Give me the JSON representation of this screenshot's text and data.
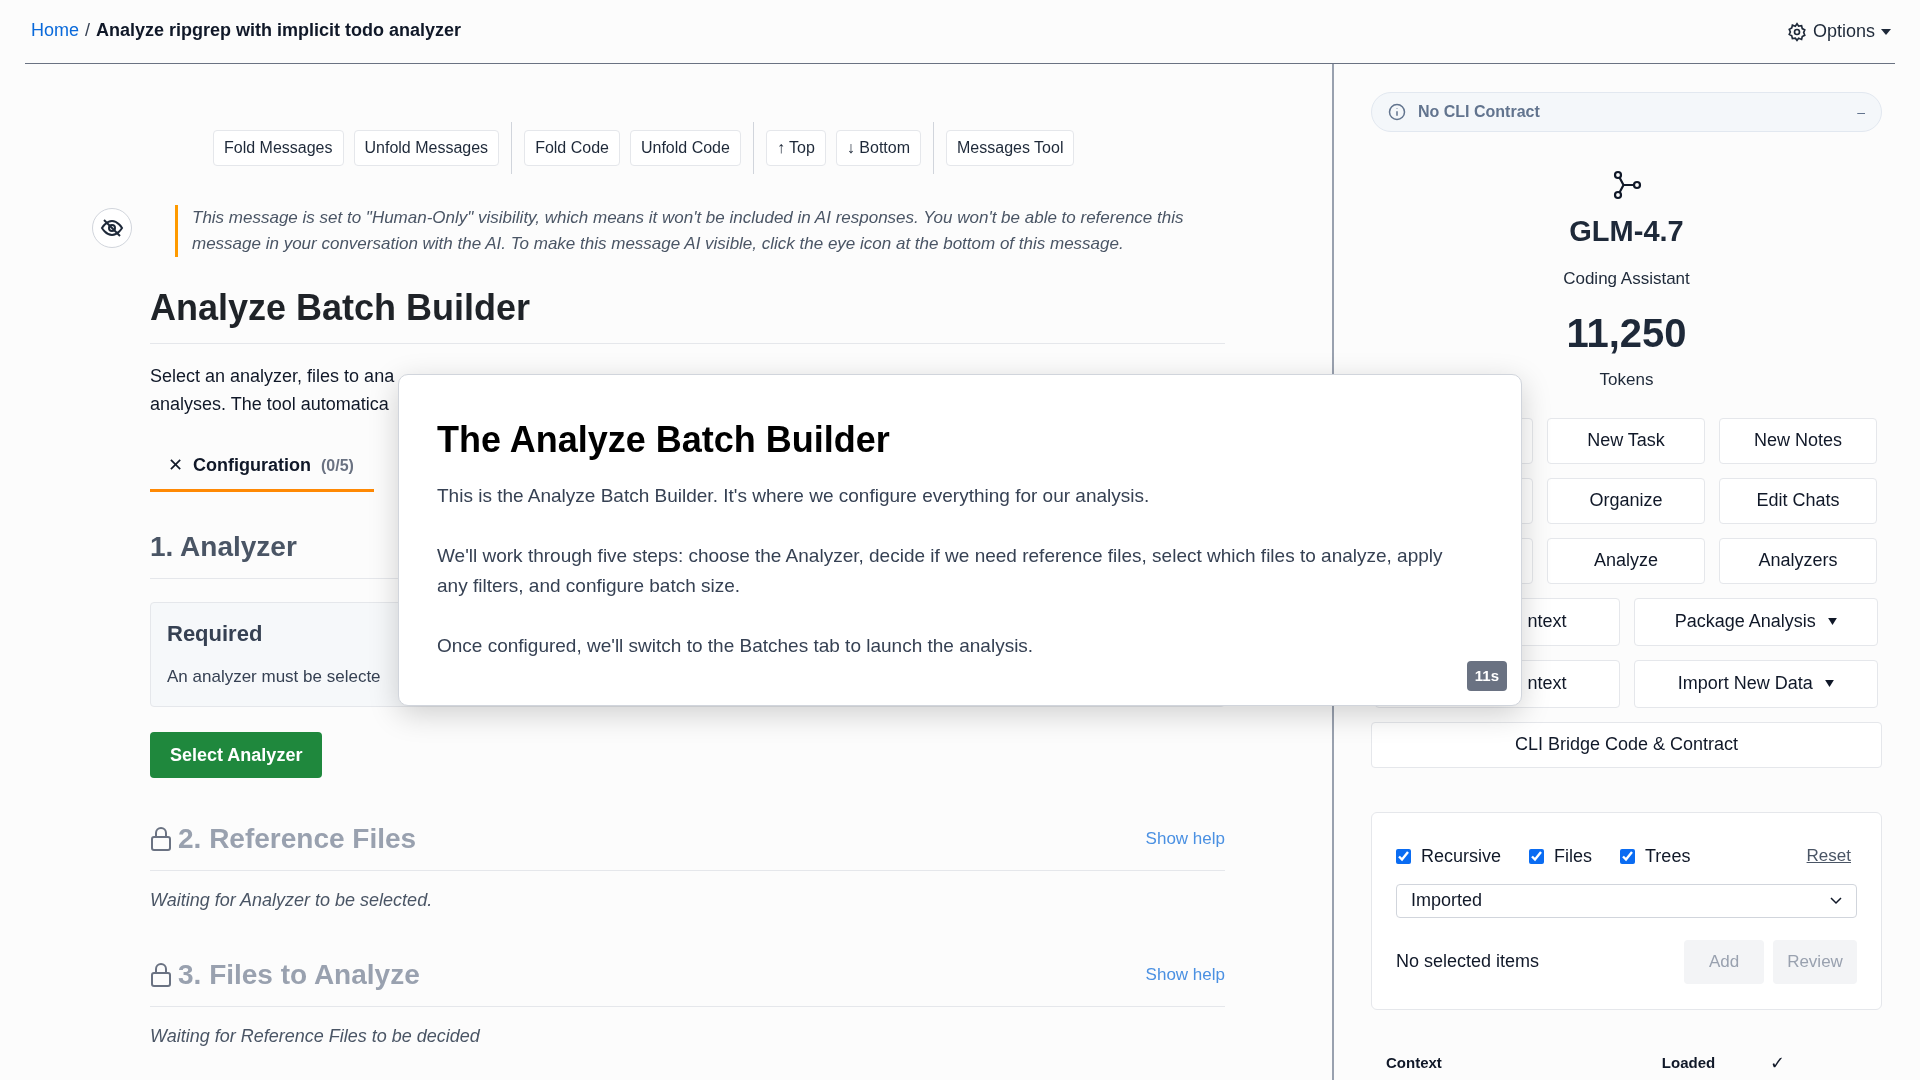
{
  "breadcrumb": [
    {
      "label": "Home",
      "kind": "link"
    },
    {
      "label": "/",
      "kind": "separator"
    },
    {
      "label": "Analyze ripgrep with implicit todo analyzer",
      "kind": "current"
    }
  ],
  "options_menu": {
    "label": "Options"
  },
  "toolbar": [
    [
      "Fold Messages",
      "Unfold Messages"
    ],
    [
      "Fold Code",
      "Unfold Code"
    ],
    [
      "↑ Top",
      "↓ Bottom"
    ],
    [
      "Messages Tool"
    ]
  ],
  "visibility_notice": {
    "text": "This message is set to \"Human-Only\" visibility, which means it won't be included in AI responses. You won't be able to reference this message in your conversation with the AI. To make this message AI visible, click the eye icon at the bottom of this message."
  },
  "page": {
    "title": "Analyze Batch Builder",
    "description_lines": [
      "Select an analyzer, files to ana",
      "analyses. The tool automatica"
    ],
    "tabs": [
      {
        "icon": "✕",
        "label": "Configuration",
        "count": "(0/5)",
        "selected": true
      }
    ],
    "steps": [
      {
        "title": "1. Analyzer",
        "locked": false,
        "required": {
          "heading": "Required",
          "text": "An analyzer must be selecte"
        },
        "action": "Select Analyzer"
      },
      {
        "title": "2. Reference Files",
        "locked": true,
        "help": "Show help",
        "status": "Waiting for Analyzer to be selected."
      },
      {
        "title": "3. Files to Analyze",
        "locked": true,
        "help": "Show help",
        "status": "Waiting for Reference Files to be decided"
      }
    ]
  },
  "modal": {
    "title": "The Analyze Batch Builder",
    "paragraphs": [
      "This is the Analyze Batch Builder. It's where we configure everything for our analysis.",
      "We'll work through five steps: choose the Analyzer, decide if we need reference files, select which files to analyze, apply any filters, and configure batch size.",
      "Once configured, we'll switch to the Batches tab to launch the analysis."
    ],
    "timer": "11s"
  },
  "sidebar": {
    "contract": {
      "label": "No CLI Contract",
      "toggle": "–"
    },
    "model": "GLM-4.7",
    "role": "Coding Assistant",
    "tokens": "11,250",
    "tokens_label": "Tokens",
    "action_rows": [
      {
        "kind": "triple",
        "hidden_first": true,
        "buttons": [
          {
            "label": "New Task"
          },
          {
            "label": "New Notes"
          }
        ]
      },
      {
        "kind": "triple",
        "hidden_first": true,
        "buttons": [
          {
            "label": "Organize"
          },
          {
            "label": "Edit Chats"
          }
        ]
      },
      {
        "kind": "triple",
        "hidden_first": true,
        "buttons": [
          {
            "label": "Analyze"
          },
          {
            "label": "Analyzers"
          }
        ]
      },
      {
        "kind": "double",
        "hidden_first": false,
        "buttons": [
          {
            "label": "ntext",
            "partial": true
          },
          {
            "label": "Package Analysis",
            "dropdown": true
          }
        ]
      },
      {
        "kind": "double",
        "hidden_first": false,
        "buttons": [
          {
            "label": "ntext",
            "partial": true
          },
          {
            "label": "Import New Data",
            "dropdown": true
          }
        ]
      },
      {
        "kind": "single",
        "hidden_first": false,
        "buttons": [
          {
            "label": "CLI Bridge Code & Contract"
          }
        ]
      }
    ],
    "filters": {
      "options": [
        {
          "label": "Recursive",
          "checked": true
        },
        {
          "label": "Files",
          "checked": true
        },
        {
          "label": "Trees",
          "checked": true
        }
      ],
      "reset": "Reset",
      "source": "Imported",
      "selection": "No selected items",
      "buttons": [
        {
          "label": "Add",
          "disabled": true
        },
        {
          "label": "Review",
          "disabled": true
        }
      ]
    },
    "context_table": {
      "columns": [
        "Context",
        "Loaded"
      ],
      "status": "✓"
    }
  }
}
